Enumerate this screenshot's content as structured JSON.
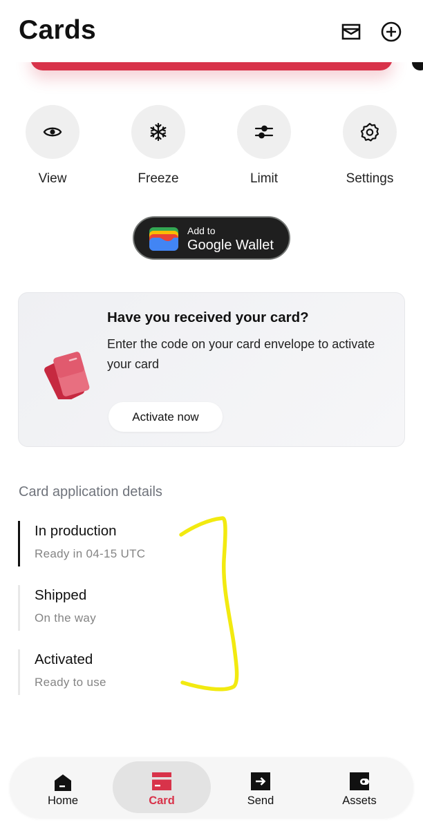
{
  "header": {
    "title": "Cards",
    "icons": [
      "inbox-icon",
      "add-circle-icon"
    ]
  },
  "actions": [
    {
      "label": "View",
      "icon": "eye-icon"
    },
    {
      "label": "Freeze",
      "icon": "snowflake-icon"
    },
    {
      "label": "Limit",
      "icon": "sliders-icon"
    },
    {
      "label": "Settings",
      "icon": "gear-icon"
    }
  ],
  "google_wallet": {
    "line1": "Add to",
    "line2": "Google Wallet"
  },
  "activate_card": {
    "title": "Have you received your card?",
    "text": "Enter the code on your card envelope to activate your card",
    "button": "Activate now",
    "illustration": "red-cards-illustration"
  },
  "application": {
    "title": "Card application details",
    "steps": [
      {
        "title": "In production",
        "subtitle": "Ready in 04-15 UTC",
        "active": true
      },
      {
        "title": "Shipped",
        "subtitle": "On the way",
        "active": false
      },
      {
        "title": "Activated",
        "subtitle": "Ready to use",
        "active": false
      }
    ]
  },
  "nav": {
    "items": [
      {
        "label": "Home",
        "icon": "home-icon",
        "active": false
      },
      {
        "label": "Card",
        "icon": "card-icon",
        "active": true
      },
      {
        "label": "Send",
        "icon": "send-icon",
        "active": false
      },
      {
        "label": "Assets",
        "icon": "wallet-icon",
        "active": false
      }
    ]
  },
  "colors": {
    "accent": "#d8334a",
    "annotation": "#f2ea10",
    "text_muted": "#848484"
  }
}
